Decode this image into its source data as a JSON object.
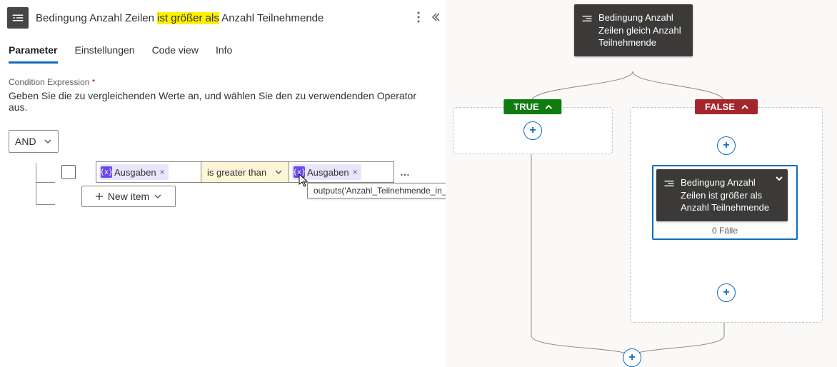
{
  "header": {
    "title_pre": "Bedingung Anzahl Zeilen ",
    "title_hl": "ist größer als",
    "title_post": " Anzahl Teilnehmende"
  },
  "tabs": {
    "parameter": "Parameter",
    "settings": "Einstellungen",
    "code": "Code view",
    "info": "Info"
  },
  "condition": {
    "label": "Condition Expression",
    "req": "*",
    "desc": "Geben Sie die zu vergleichenden Werte an, und wählen Sie den zu verwendenden Operator aus.",
    "logic": "AND",
    "left_token": "Ausgaben",
    "operator": "is greater than",
    "right_token": "Ausgaben",
    "token_symbol": "{x}",
    "remove": "×",
    "more": "…",
    "new_item": "New item"
  },
  "tooltip": "outputs('Anzahl_Teilnehmende_in_Gruppe_A')",
  "flow": {
    "parent_title": "Bedingung Anzahl Zeilen gleich Anzahl Teilnehmende",
    "true_label": "TRUE",
    "false_label": "FALSE",
    "child_title": "Bedingung Anzahl Zeilen ist größer als Anzahl Teilnehmende",
    "cases": "0 Fälle"
  }
}
